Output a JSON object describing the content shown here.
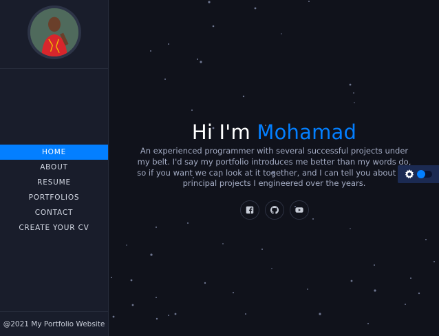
{
  "sidebar": {
    "nav": [
      {
        "label": "HOME",
        "active": true
      },
      {
        "label": "ABOUT",
        "active": false
      },
      {
        "label": "RESUME",
        "active": false
      },
      {
        "label": "PORTFOLIOS",
        "active": false
      },
      {
        "label": "CONTACT",
        "active": false
      },
      {
        "label": "CREATE YOUR CV",
        "active": false
      }
    ],
    "footer": "@2021 My Portfolio Website"
  },
  "hero": {
    "greeting": "Hi I'm",
    "name": "Mohamad",
    "description": "An experienced programmer with several successful projects under my belt. I'd say my portfolio introduces me better than my words do, so if you want we can look at it together, and I can tell you about the principal projects I engineered over the years."
  },
  "socials": [
    {
      "icon": "facebook-icon"
    },
    {
      "icon": "github-icon"
    },
    {
      "icon": "youtube-icon"
    }
  ],
  "theme": {
    "icon": "gear-icon",
    "accent": "#037fff"
  }
}
